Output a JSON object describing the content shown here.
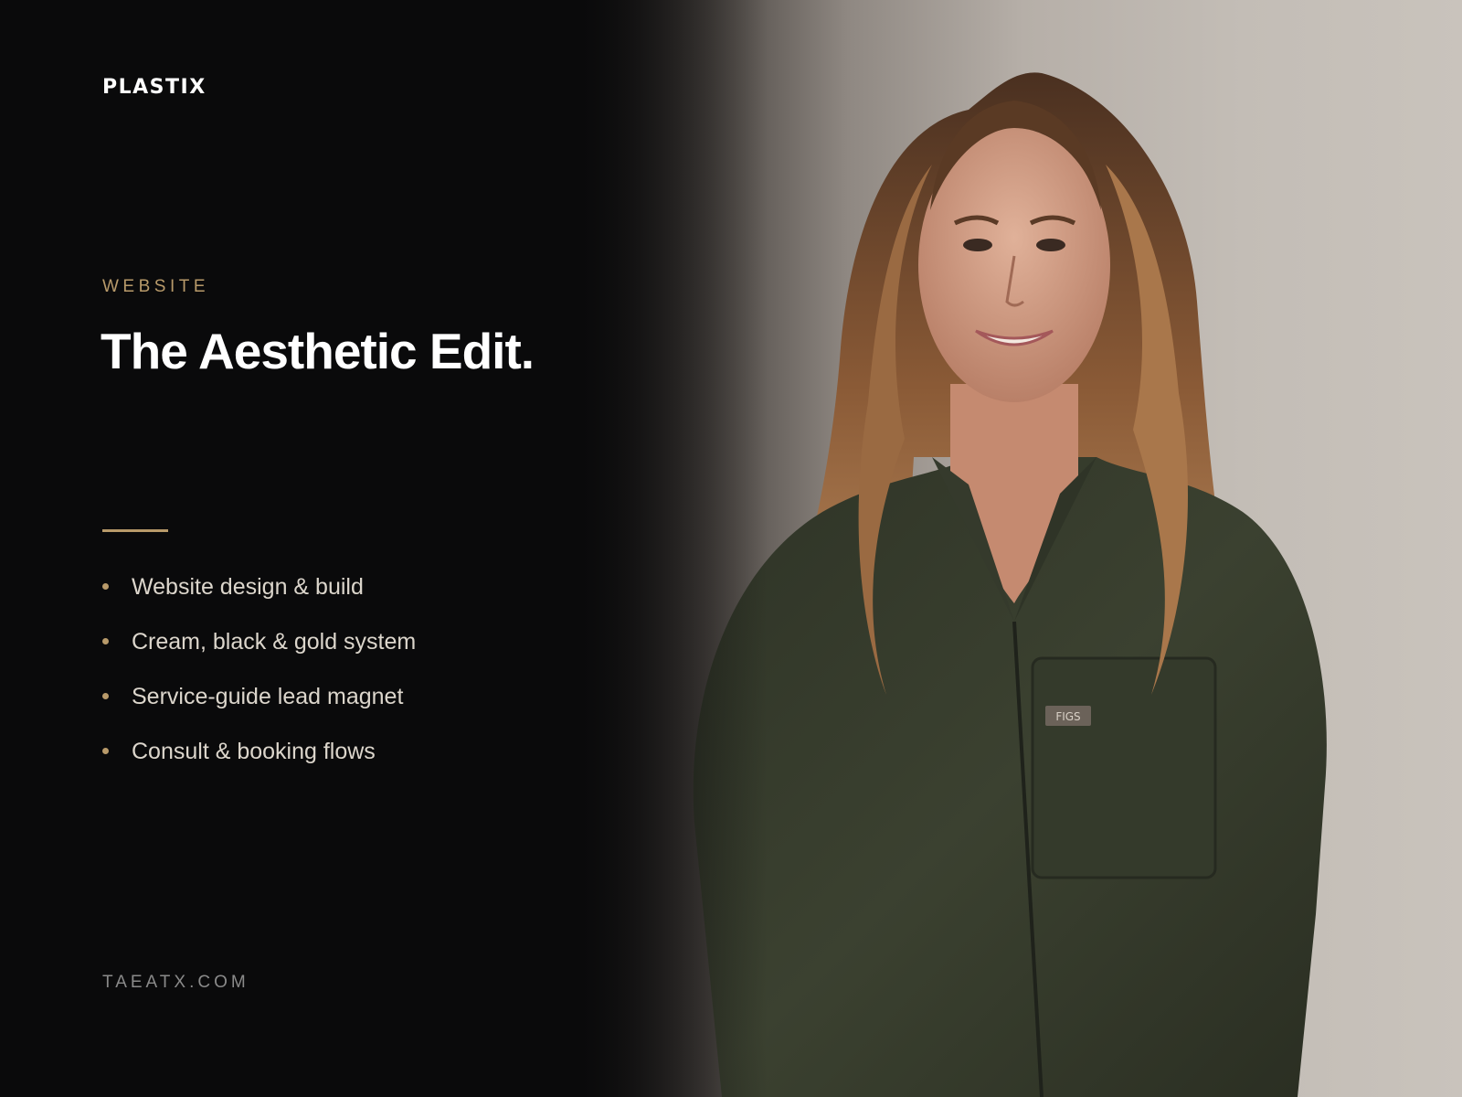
{
  "brand": {
    "logo_text": "PLASTIX"
  },
  "project": {
    "category": "WEBSITE",
    "title": "The Aesthetic Edit.",
    "features": [
      "Website design & build",
      "Cream, black & gold system",
      "Service-guide lead magnet",
      "Consult & booking flows"
    ],
    "domain": "TAEATX.COM"
  },
  "photo": {
    "subject": "portrait",
    "badge_text": "FIGS"
  },
  "colors": {
    "background": "#0a0a0b",
    "accent_gold": "#b89a6a",
    "text_primary": "#ffffff",
    "text_secondary": "#dcd6cc",
    "text_muted": "#8a8a8a"
  }
}
